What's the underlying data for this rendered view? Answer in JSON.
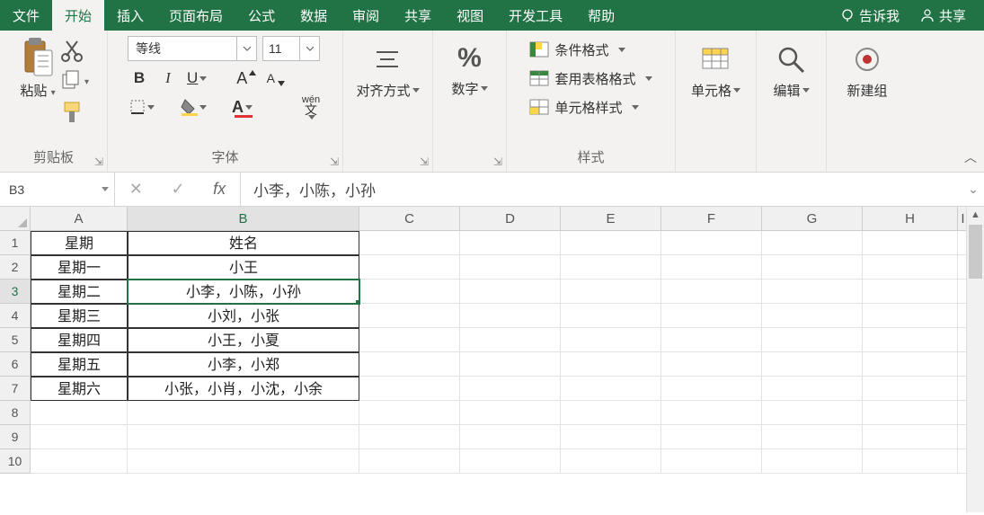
{
  "tabs": {
    "items": [
      "文件",
      "开始",
      "插入",
      "页面布局",
      "公式",
      "数据",
      "审阅",
      "共享",
      "视图",
      "开发工具",
      "帮助"
    ],
    "active_index": 1,
    "tellme": "告诉我",
    "share": "共享"
  },
  "ribbon": {
    "clipboard": {
      "paste": "粘贴",
      "group": "剪贴板"
    },
    "font": {
      "name": "等线",
      "size": "11",
      "group": "字体",
      "ruby": "wén",
      "ruby2": "文"
    },
    "align": {
      "label": "对齐方式"
    },
    "number": {
      "symbol": "%",
      "label": "数字"
    },
    "styles": {
      "conditional": "条件格式",
      "tableformat": "套用表格格式",
      "cellstyle": "单元格样式",
      "group": "样式"
    },
    "cells": {
      "label": "单元格"
    },
    "editing": {
      "label": "编辑"
    },
    "newgroup": {
      "label": "新建组"
    }
  },
  "formula_bar": {
    "name_box": "B3",
    "value": "小李，小陈，小孙"
  },
  "grid": {
    "columns": [
      "A",
      "B",
      "C",
      "D",
      "E",
      "F",
      "G",
      "H",
      "I"
    ],
    "selected_cell": {
      "row": 3,
      "col": "B"
    },
    "rows": [
      {
        "n": 1,
        "A": "星期",
        "B": "姓名"
      },
      {
        "n": 2,
        "A": "星期一",
        "B": "小王"
      },
      {
        "n": 3,
        "A": "星期二",
        "B": "小李，小陈，小孙"
      },
      {
        "n": 4,
        "A": "星期三",
        "B": "小刘，小张"
      },
      {
        "n": 5,
        "A": "星期四",
        "B": "小王，小夏"
      },
      {
        "n": 6,
        "A": "星期五",
        "B": "小李，小郑"
      },
      {
        "n": 7,
        "A": "星期六",
        "B": "小张，小肖，小沈，小余"
      },
      {
        "n": 8,
        "A": "",
        "B": ""
      },
      {
        "n": 9,
        "A": "",
        "B": ""
      },
      {
        "n": 10,
        "A": "",
        "B": ""
      }
    ]
  }
}
